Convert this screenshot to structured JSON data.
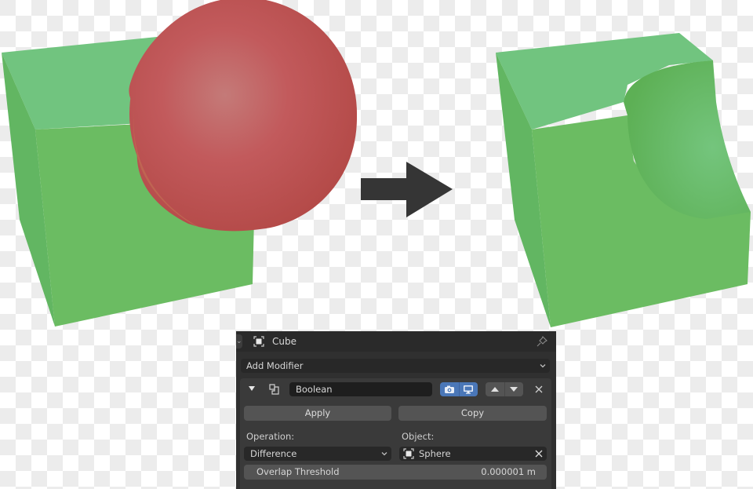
{
  "illustration": {
    "before_label": "cube-and-sphere",
    "after_label": "cube-with-spherical-cut",
    "arrow": "right-arrow",
    "colors": {
      "cube_front": "#6bbc62",
      "cube_top": "#71c47f",
      "cube_side": "#62b662",
      "sphere": "#c15552",
      "arrow": "#353535"
    }
  },
  "panel": {
    "header": {
      "object_name": "Cube",
      "object_icon": "object-icon",
      "pin_icon": "pin-icon"
    },
    "add_modifier": {
      "label": "Add Modifier"
    },
    "modifier": {
      "name": "Boolean",
      "type_icon": "boolean-modifier-icon",
      "render_toggle_icon": "camera-icon",
      "viewport_toggle_icon": "monitor-icon",
      "accent": "#4a77b8",
      "apply_label": "Apply",
      "copy_label": "Copy",
      "operation_label": "Operation:",
      "operation_value": "Difference",
      "object_label": "Object:",
      "object_value": "Sphere",
      "overlap_label": "Overlap Threshold",
      "overlap_value": "0.000001 m"
    }
  }
}
